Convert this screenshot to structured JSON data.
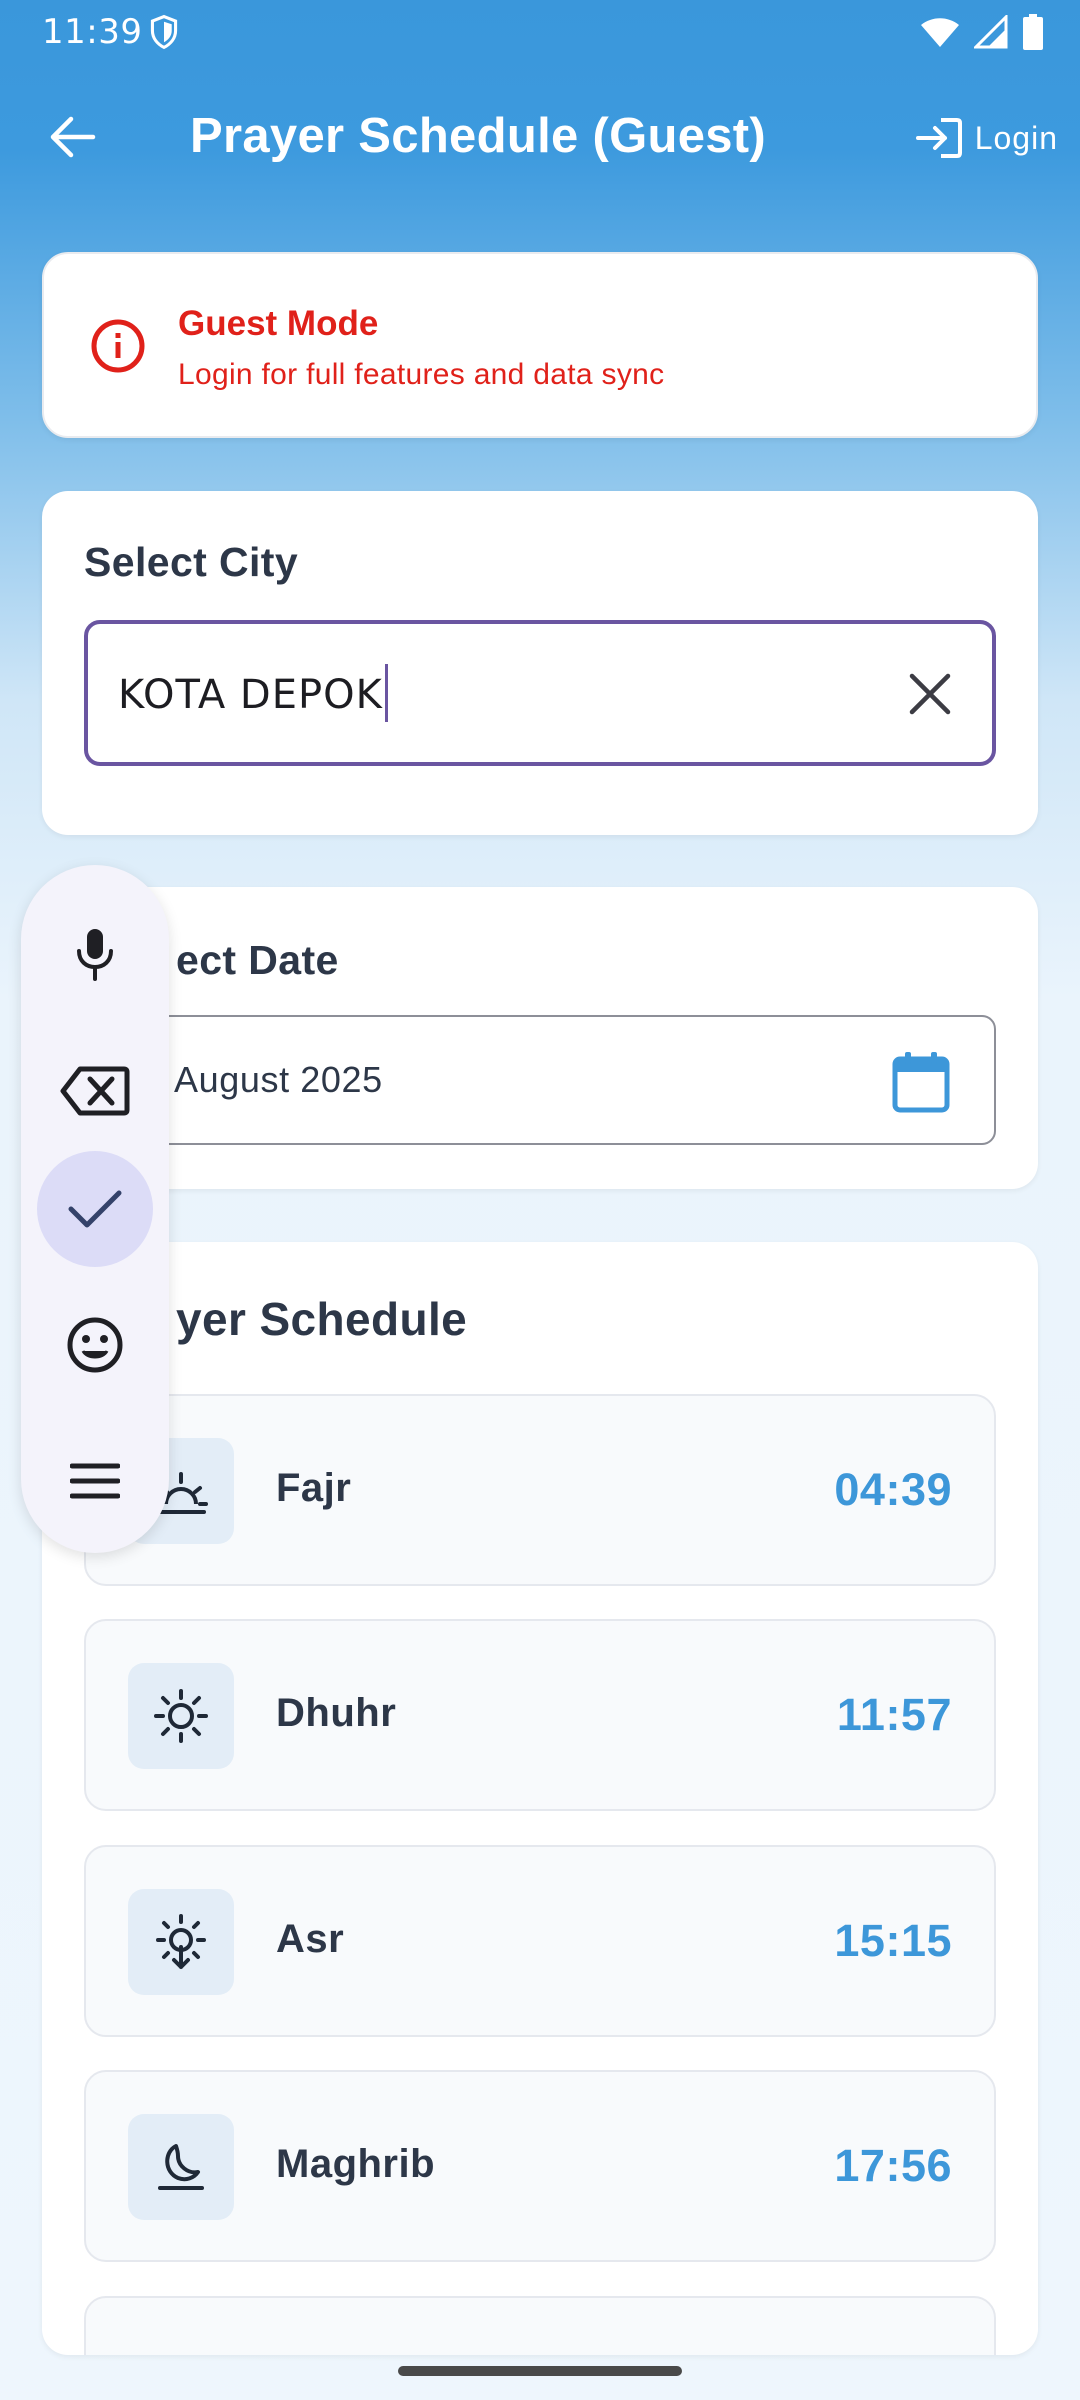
{
  "status_bar": {
    "time": "11:39"
  },
  "app_bar": {
    "title": "Prayer Schedule (Guest)",
    "login_label": "Login"
  },
  "guest_banner": {
    "title": "Guest Mode",
    "message": "Login for full features and data sync"
  },
  "city_section": {
    "heading": "Select City",
    "value": "KOTA DEPOK"
  },
  "date_section": {
    "heading": "ect Date",
    "value": "August 2025"
  },
  "schedule_section": {
    "heading": "yer Schedule",
    "prayers": [
      {
        "name": "Fajr",
        "time": "04:39",
        "icon": "sunrise-icon"
      },
      {
        "name": "Dhuhr",
        "time": "11:57",
        "icon": "sun-icon"
      },
      {
        "name": "Asr",
        "time": "15:15",
        "icon": "sun-down-icon"
      },
      {
        "name": "Maghrib",
        "time": "17:56",
        "icon": "moon-icon"
      }
    ]
  },
  "keyboard_toolbar": {
    "tools": [
      "mic-icon",
      "backspace-icon",
      "check-icon",
      "emoji-icon",
      "menu-icon"
    ],
    "active": "check-icon"
  },
  "colors": {
    "accent": "#3d97d9",
    "danger": "#e0211a",
    "focus": "#6a55a1",
    "text": "#2d3748"
  }
}
